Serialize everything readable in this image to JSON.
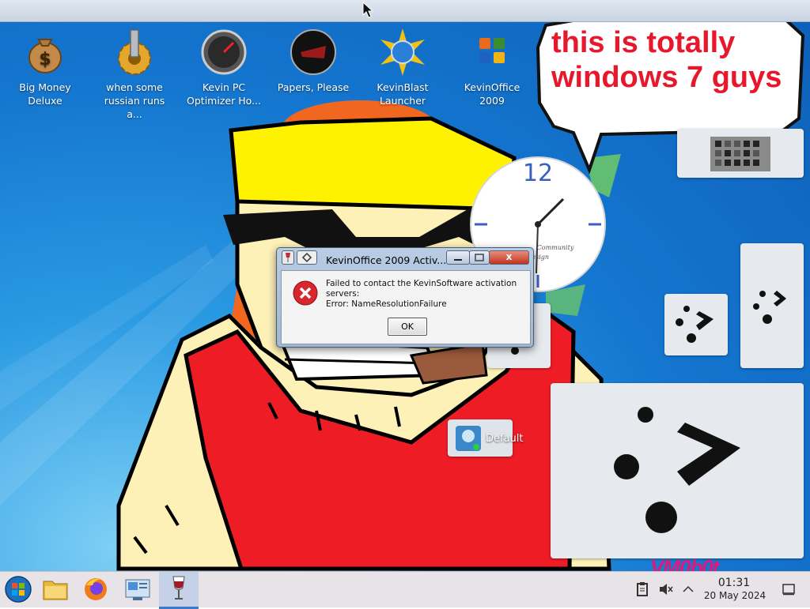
{
  "desktop": {
    "icons": [
      {
        "label": "Big Money\nDeluxe",
        "icon": "money-bag-icon"
      },
      {
        "label": "when some\nrussian runs a...",
        "icon": "gear-icon"
      },
      {
        "label": "Kevin PC\nOptimizer Ho...",
        "icon": "gauge-icon"
      },
      {
        "label": "Papers, Please",
        "icon": "papers-please-icon"
      },
      {
        "label": "KevinBlast\nLauncher",
        "icon": "starburst-globe-icon"
      },
      {
        "label": "KevinOffice\n2009",
        "icon": "office-logo-icon"
      }
    ],
    "speech_bubble_text": "this is totally windows 7 guys",
    "clock_gadget": {
      "numeral": "12",
      "community_text": "Community",
      "design_text": "Design"
    },
    "default_label": "Default",
    "watermark": "VM0b0t"
  },
  "dialog": {
    "title": "KevinOffice 2009 Activ...",
    "message_lines": [
      "Failed to contact the KevinSoftware activation",
      "servers:",
      "Error: NameResolutionFailure"
    ],
    "ok_label": "OK",
    "close_label": "x"
  },
  "taskbar": {
    "items": [
      "start-orb-icon",
      "file-manager-icon",
      "firefox-icon",
      "system-settings-icon",
      "wine-glass-icon"
    ],
    "clock_time": "01:31",
    "clock_date": "20 May 2024"
  }
}
